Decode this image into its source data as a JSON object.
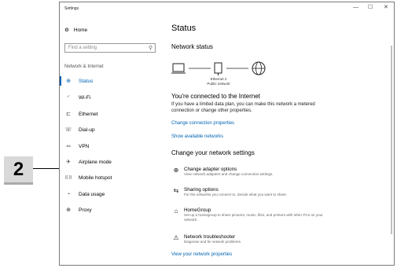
{
  "window": {
    "title": "Settings",
    "minimize": "—",
    "maximize": "☐",
    "close": "✕"
  },
  "sidebar": {
    "home": "Home",
    "search_placeholder": "Find a setting",
    "section": "Network & Internet",
    "items": [
      {
        "label": "Status",
        "icon": "⊕",
        "active": true
      },
      {
        "label": "Wi-Fi",
        "icon": "◜",
        "active": false
      },
      {
        "label": "Ethernet",
        "icon": "⊏",
        "active": false
      },
      {
        "label": "Dial-up",
        "icon": "☏",
        "active": false
      },
      {
        "label": "VPN",
        "icon": "∾",
        "active": false
      },
      {
        "label": "Airplane mode",
        "icon": "✈",
        "active": false
      },
      {
        "label": "Mobile hotspot",
        "icon": "((·))",
        "active": false
      },
      {
        "label": "Data usage",
        "icon": "◔",
        "active": false
      },
      {
        "label": "Proxy",
        "icon": "⊕",
        "active": false
      }
    ]
  },
  "main": {
    "title": "Status",
    "network_status": "Network status",
    "diagram_label1": "Ethernet 2",
    "diagram_label2": "Public network",
    "connected": "You're connected to the Internet",
    "connected_desc": "If you have a limited data plan, you can make this network a metered connection or change other properties.",
    "link_change_props": "Change connection properties",
    "link_show_networks": "Show available networks",
    "change_heading": "Change your network settings",
    "items": [
      {
        "title": "Change adapter options",
        "desc": "View network adapters and change connection settings.",
        "icon": "⊕"
      },
      {
        "title": "Sharing options",
        "desc": "For the networks you connect to, decide what you want to share.",
        "icon": "⇆"
      },
      {
        "title": "HomeGroup",
        "desc": "Set up a homegroup to share pictures, music, files, and printers with other PCs on your network.",
        "icon": "⌂"
      },
      {
        "title": "Network troubleshooter",
        "desc": "Diagnose and fix network problems.",
        "icon": "⚠"
      }
    ],
    "link_view_props": "View your network properties"
  },
  "callout": {
    "number": "2"
  }
}
